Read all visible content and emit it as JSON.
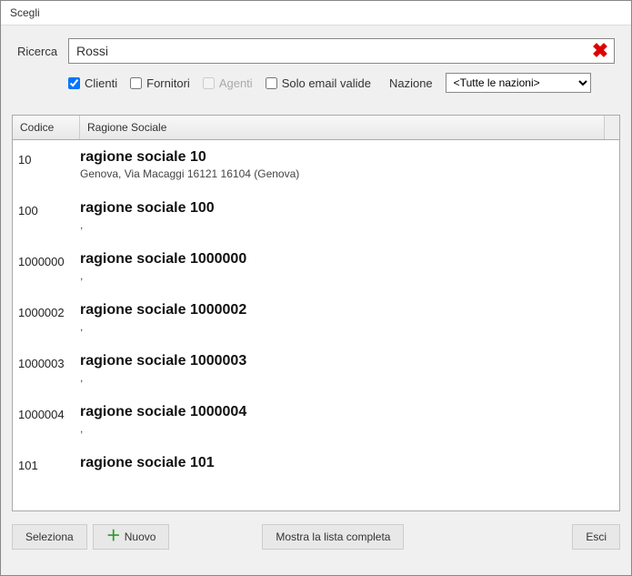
{
  "window": {
    "title": "Scegli"
  },
  "search": {
    "label": "Ricerca",
    "value": "Rossi"
  },
  "filters": {
    "clienti": {
      "label": "Clienti",
      "checked": true
    },
    "fornitori": {
      "label": "Fornitori",
      "checked": false
    },
    "agenti": {
      "label": "Agenti",
      "checked": false,
      "disabled": true
    },
    "soloEmail": {
      "label": "Solo email valide",
      "checked": false
    },
    "nazioneLabel": "Nazione",
    "nazioneValue": "<Tutte le nazioni>"
  },
  "grid": {
    "headers": {
      "code": "Codice",
      "name": "Ragione Sociale"
    },
    "rows": [
      {
        "code": "10",
        "title": "ragione sociale 10",
        "sub": "Genova, Via Macaggi 16121 16104 (Genova)"
      },
      {
        "code": "100",
        "title": "ragione sociale 100",
        "sub": ","
      },
      {
        "code": "1000000",
        "title": "ragione sociale 1000000",
        "sub": ","
      },
      {
        "code": "1000002",
        "title": "ragione sociale 1000002",
        "sub": ","
      },
      {
        "code": "1000003",
        "title": "ragione sociale 1000003",
        "sub": ","
      },
      {
        "code": "1000004",
        "title": "ragione sociale 1000004",
        "sub": ","
      },
      {
        "code": "101",
        "title": "ragione sociale 101",
        "sub": ""
      }
    ]
  },
  "footer": {
    "select": "Seleziona",
    "new": "Nuovo",
    "showFull": "Mostra la lista completa",
    "exit": "Esci"
  }
}
